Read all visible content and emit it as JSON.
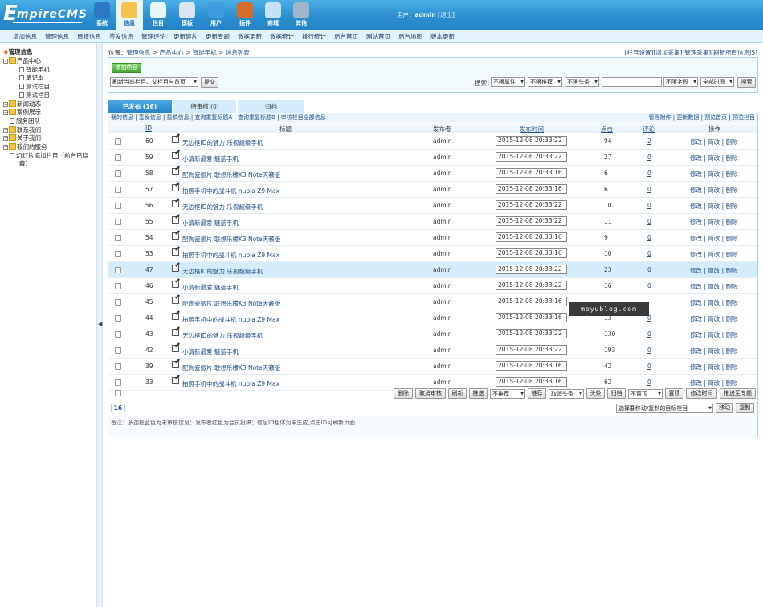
{
  "logo": {
    "first": "E",
    "rest": "mpireCMS"
  },
  "mainnav": [
    {
      "label": "系统",
      "icon": "globe-icon",
      "color": "#2d77c4"
    },
    {
      "label": "信息",
      "icon": "edit-icon",
      "color": "#f6c44c",
      "active": true
    },
    {
      "label": "栏目",
      "icon": "folder-icon",
      "color": "#e7f4fc"
    },
    {
      "label": "模板",
      "icon": "template-icon",
      "color": "#d9e6f0"
    },
    {
      "label": "用户",
      "icon": "user-icon",
      "color": "#3f9be0"
    },
    {
      "label": "插件",
      "icon": "tools-icon",
      "color": "#d86a2c"
    },
    {
      "label": "商城",
      "icon": "shop-icon",
      "color": "#c7e0f2"
    },
    {
      "label": "其他",
      "icon": "gear-icon",
      "color": "#9fb7c8"
    }
  ],
  "user": {
    "prefix": "用户：",
    "name": "admin",
    "logout": "[退出]"
  },
  "subnav": [
    "增加信息",
    "管理信息",
    "审核信息",
    "签发信息",
    "管理评论",
    "更新碎片",
    "更新专题",
    "数据更新",
    "数据统计",
    "排行统计",
    "后台首页",
    "网站首页",
    "后台地图",
    "版本更新"
  ],
  "tree": {
    "root": "管理信息",
    "items": [
      {
        "label": "产品中心",
        "level": 0,
        "type": "open"
      },
      {
        "label": "智能手机",
        "level": 1,
        "type": "doc"
      },
      {
        "label": "笔记本",
        "level": 1,
        "type": "doc"
      },
      {
        "label": "测试栏目",
        "level": 1,
        "type": "doc"
      },
      {
        "label": "测试栏目",
        "level": 1,
        "type": "doc"
      },
      {
        "label": "新闻动态",
        "level": 0,
        "type": "closed"
      },
      {
        "label": "案例展示",
        "level": 0,
        "type": "closed"
      },
      {
        "label": "服务团队",
        "level": 0,
        "type": "doc"
      },
      {
        "label": "联系我们",
        "level": 0,
        "type": "closed"
      },
      {
        "label": "关于我们",
        "level": 0,
        "type": "closed"
      },
      {
        "label": "我们的服务",
        "level": 0,
        "type": "closed"
      },
      {
        "label": "幻灯片添加栏目（前台已隐",
        "level": 0,
        "type": "doc"
      },
      {
        "label": "藏）",
        "level": 0,
        "type": "wrap"
      }
    ]
  },
  "crumb": {
    "prefix": "位置：",
    "parts": [
      "管理信息",
      "产品中心",
      "智能手机",
      "信息列表"
    ],
    "sep": ">"
  },
  "toplinks": [
    "[栏目设置]",
    "[增加采集]",
    "[管理采集]",
    "[刷新所有信息JS]"
  ],
  "toolbar": {
    "add": "增加信息",
    "refresh_select": "刷新当前栏目、父栏目与首页",
    "submit": "提交",
    "search_label": "搜索：",
    "filter1": "不限属性",
    "filter2": "不限推荐",
    "filter3": "不限头条",
    "search_placeholder": "",
    "field": "不限字段",
    "time": "全部时间",
    "search_btn": "搜索"
  },
  "tabs": [
    {
      "label": "已发布 (16)",
      "active": true
    },
    {
      "label": "待审核 (0)",
      "active": false
    },
    {
      "label": "归档",
      "active": false
    }
  ],
  "oplinks_left": [
    "我的信息",
    "签发信息",
    "投稿信息",
    "查询重复标题A",
    "查询重复标题B",
    "审核栏目全部信息"
  ],
  "oplinks_right": [
    "管理附件",
    "更新数据",
    "预览首页",
    "预览栏目"
  ],
  "columns": {
    "id": "ID",
    "title": "标题",
    "author": "发布者",
    "time": "发布时间",
    "hits": "点击",
    "comments": "评论",
    "ops": "操作"
  },
  "rows": [
    {
      "id": "60",
      "title": "无边框ID的魅力 乐视超级手机",
      "author": "admin",
      "time": "2015-12-08 20:33:22",
      "hits": "94",
      "comments": "2",
      "ops": "修改 | 简改 | 删除"
    },
    {
      "id": "59",
      "title": "小清新最爱 魅蓝手机",
      "author": "admin",
      "time": "2015-12-08 20:33:22",
      "hits": "27",
      "comments": "0",
      "ops": "修改 | 简改 | 删除"
    },
    {
      "id": "58",
      "title": "配陶瓷振片 联想乐檬K3 Note天籁版",
      "author": "admin",
      "time": "2015-12-08 20:33:16",
      "hits": "6",
      "comments": "0",
      "ops": "修改 | 简改 | 删除"
    },
    {
      "id": "57",
      "title": "拍照手机中的战斗机 nubia Z9 Max",
      "author": "admin",
      "time": "2015-12-08 20:33:16",
      "hits": "6",
      "comments": "0",
      "ops": "修改 | 简改 | 删除"
    },
    {
      "id": "56",
      "title": "无边框ID的魅力 乐视超级手机",
      "author": "admin",
      "time": "2015-12-08 20:33:22",
      "hits": "10",
      "comments": "0",
      "ops": "修改 | 简改 | 删除"
    },
    {
      "id": "55",
      "title": "小清新最爱 魅蓝手机",
      "author": "admin",
      "time": "2015-12-08 20:33:22",
      "hits": "11",
      "comments": "0",
      "ops": "修改 | 简改 | 删除"
    },
    {
      "id": "54",
      "title": "配陶瓷振片 联想乐檬K3 Note天籁版",
      "author": "admin",
      "time": "2015-12-08 20:33:16",
      "hits": "9",
      "comments": "0",
      "ops": "修改 | 简改 | 删除"
    },
    {
      "id": "53",
      "title": "拍照手机中的战斗机 nubia Z9 Max",
      "author": "admin",
      "time": "2015-12-08 20:33:16",
      "hits": "10",
      "comments": "0",
      "ops": "修改 | 简改 | 删除"
    },
    {
      "id": "47",
      "title": "无边框ID的魅力 乐视超级手机",
      "author": "admin",
      "time": "2015-12-08 20:33:22",
      "hits": "23",
      "comments": "0",
      "ops": "修改 | 简改 | 删除"
    },
    {
      "id": "46",
      "title": "小清新最爱 魅蓝手机",
      "author": "admin",
      "time": "2015-12-08 20:33:22",
      "hits": "16",
      "comments": "0",
      "ops": "修改 | 简改 | 删除"
    },
    {
      "id": "45",
      "title": "配陶瓷振片 联想乐檬K3 Note天籁版",
      "author": "admin",
      "time": "2015-12-08 20:33:16",
      "hits": "",
      "comments": "",
      "ops": "修改 | 简改 | 删除"
    },
    {
      "id": "44",
      "title": "拍照手机中的战斗机 nubia Z9 Max",
      "author": "admin",
      "time": "2015-12-08 20:33:16",
      "hits": "13",
      "comments": "0",
      "ops": "修改 | 简改 | 删除"
    },
    {
      "id": "43",
      "title": "无边框ID的魅力 乐视超级手机",
      "author": "admin",
      "time": "2015-12-08 20:33:22",
      "hits": "130",
      "comments": "0",
      "ops": "修改 | 简改 | 删除"
    },
    {
      "id": "42",
      "title": "小清新最爱 魅蓝手机",
      "author": "admin",
      "time": "2015-12-08 20:33:22",
      "hits": "193",
      "comments": "0",
      "ops": "修改 | 简改 | 删除"
    },
    {
      "id": "39",
      "title": "配陶瓷振片 联想乐檬K3 Note天籁版",
      "author": "admin",
      "time": "2015-12-08 20:33:16",
      "hits": "42",
      "comments": "0",
      "ops": "修改 | 简改 | 删除"
    },
    {
      "id": "33",
      "title": "拍照手机中的战斗机 nubia Z9 Max",
      "author": "admin",
      "time": "2015-12-08 20:33:16",
      "hits": "62",
      "comments": "0",
      "ops": "修改 | 简改 | 删除"
    }
  ],
  "highlight_row": 8,
  "bottom": {
    "delete": "删除",
    "unapprove": "取消审核",
    "refresh": "刷新",
    "push": "推送",
    "recommend_sel": "不推荐",
    "recommend": "推荐",
    "headline_sel": "取消头条",
    "headline": "头条",
    "archive": "归档",
    "top_sel": "不置顶",
    "top": "置顶",
    "change_time": "修改时间",
    "push_topic": "推送至专题"
  },
  "page": {
    "count": "16",
    "move_select": "选择要移动/复制的目标栏目",
    "move": "移动",
    "copy": "复制"
  },
  "note": "备注：多选框蓝色为未审核信息；发布者红色为会员投稿；信息ID粗体为未生成,点击ID可刷新页面.",
  "watermark": "moyublog.com"
}
